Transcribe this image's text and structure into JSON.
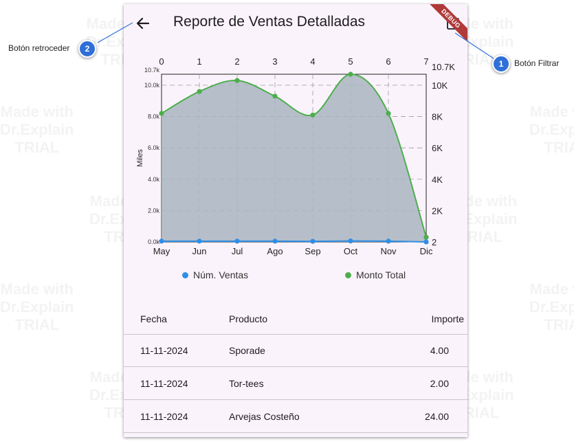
{
  "appbar": {
    "title": "Reporte de Ventas Detalladas",
    "debug_banner": "DEBUG"
  },
  "chart_data": {
    "type": "area",
    "x_top_ticks": [
      "0",
      "1",
      "2",
      "3",
      "4",
      "5",
      "6",
      "7"
    ],
    "categories": [
      "May",
      "Jun",
      "Jul",
      "Ago",
      "Sep",
      "Oct",
      "Nov",
      "Dic"
    ],
    "left_axis": {
      "label": "Miles",
      "ticks": [
        "0.0k",
        "2.0k",
        "4.0k",
        "6.0k",
        "8.0k",
        "10.0k"
      ],
      "max_label": "10.7k",
      "range": [
        0,
        10.7
      ]
    },
    "right_axis": {
      "ticks": [
        "2",
        "2K",
        "4K",
        "6K",
        "8K",
        "10K"
      ],
      "max_label": "10.7K",
      "range": [
        0,
        10700
      ]
    },
    "series": [
      {
        "name": "Núm. Ventas",
        "color": "#2f8ee6",
        "values": [
          0.05,
          0.05,
          0.05,
          0.05,
          0.04,
          0.06,
          0.05,
          0.0
        ]
      },
      {
        "name": "Monto Total",
        "color": "#4cae4c",
        "values": [
          8.2,
          9.6,
          10.3,
          9.3,
          8.1,
          10.7,
          8.2,
          0.3
        ]
      }
    ],
    "grid": true,
    "legend_position": "bottom"
  },
  "table": {
    "headers": {
      "date": "Fecha",
      "product": "Producto",
      "amount": "Importe"
    },
    "rows": [
      {
        "date": "11-11-2024",
        "product": "Sporade",
        "amount": "4.00"
      },
      {
        "date": "11-11-2024",
        "product": "Tor-tees",
        "amount": "2.00"
      },
      {
        "date": "11-11-2024",
        "product": "Arvejas Costeño",
        "amount": "24.00"
      }
    ]
  },
  "callouts": [
    {
      "number": "1",
      "label": "Botón Filtrar"
    },
    {
      "number": "2",
      "label": "Botón retroceder"
    }
  ],
  "watermark": {
    "text": "Made with\nDr.Explain\nTRIAL"
  },
  "colors": {
    "area_fill": "#a9b5c0",
    "accent_blue": "#2f6fd8",
    "debug_red": "#b03a3a"
  }
}
